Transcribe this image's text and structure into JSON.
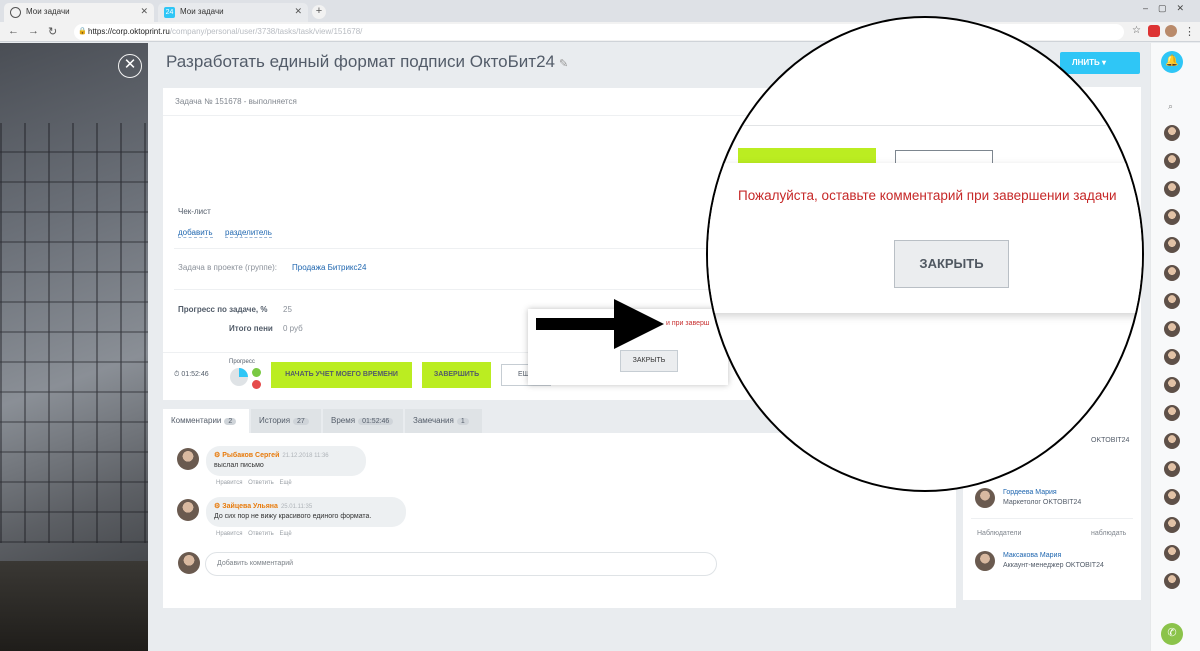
{
  "browser": {
    "tabs": [
      {
        "label": "Мои задачи",
        "active": true
      },
      {
        "label": "Мои задачи",
        "active": false
      }
    ],
    "new_tab": "+",
    "url_visible": "https://corp.oktoprint.ru",
    "url_rest": "/company/personal/user/3738/tasks/task/view/151678/",
    "b24_badge": "24"
  },
  "task": {
    "title": "Разработать единый формат подписи ОктоБит24",
    "header": "Задача № 151678 - выполняется",
    "checklist_label": "Чек-лист",
    "checklist_add": "добавить",
    "checklist_divider": "разделитель",
    "project_label": "Задача в проекте (группе):",
    "project_value": "Продажа Битрикс24",
    "progress_label": "Прогресс по задаче, %",
    "progress_value": "25",
    "penalty_label": "Итого пени",
    "penalty_value": "0 руб",
    "timer": "01:52:46",
    "progress_mini": "Прогресс",
    "btn_start_time": "НАЧАТЬ УЧЕТ МОЕГО ВРЕМЕНИ",
    "btn_finish": "ЗАВЕРШИТЬ",
    "btn_extra": "ЕЩЁ"
  },
  "small_popup": {
    "message_fragment": "и при заверш",
    "close_label": "ЗАКРЫТЬ"
  },
  "comment_tabs": [
    {
      "label": "Комментарии",
      "count": "2"
    },
    {
      "label": "История",
      "count": "27"
    },
    {
      "label": "Время",
      "count": "01:52:46"
    },
    {
      "label": "Замечания",
      "count": "1"
    }
  ],
  "comments": [
    {
      "author": "Рыбаков Сергей",
      "date": "21.12.2018 11:36",
      "text": "выслал письмо",
      "actions": "Нравится Ответить Ещё"
    },
    {
      "author": "Зайцева Ульяна",
      "date": "25.01.11:35",
      "text": "До сих пор не вижу красивого единого формата.",
      "actions": "Нравится Ответить Ещё"
    }
  ],
  "add_comment_placeholder": "Добавить комментарий",
  "right_panel": {
    "top_button": "ЛНИТЬ",
    "company_fragment": "OKTOBIT24",
    "person1_name": "Гордеева Мария",
    "person1_role": "Маркетолог OKTOBIT24",
    "observers_label": "Наблюдатели",
    "observers_action": "наблюдать",
    "person2_name": "Максакова Мария",
    "person2_role": "Аккаунт-менеджер OKTOBIT24"
  },
  "zoom": {
    "message": "Пожалуйста, оставьте комментарий при завершении задачи",
    "close_label": "ЗАКРЫТЬ"
  },
  "colors": {
    "accent_green": "#bbed21",
    "accent_blue": "#2fc6f6",
    "error_red": "#c62828"
  }
}
